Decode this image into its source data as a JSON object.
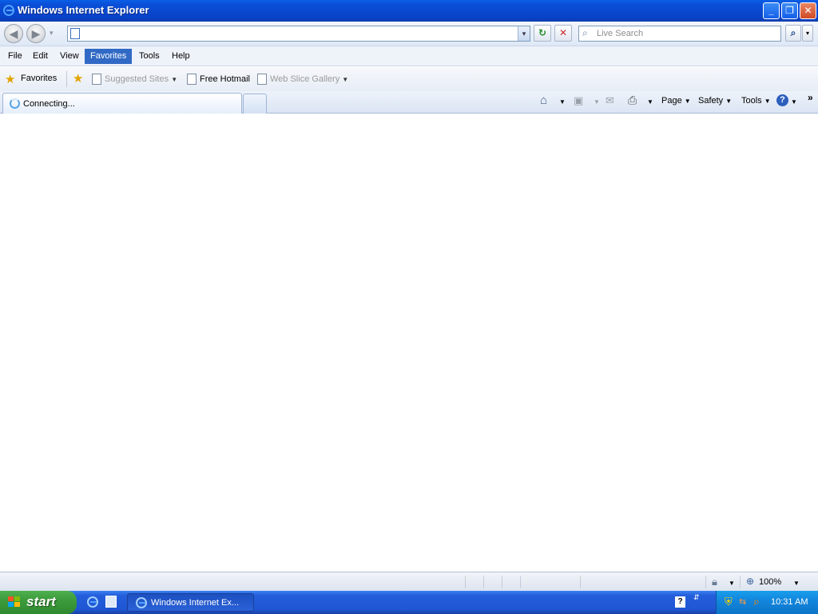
{
  "window": {
    "title": "Windows Internet Explorer"
  },
  "address": {
    "url": "",
    "search_placeholder": "Live Search"
  },
  "menu": [
    "File",
    "Edit",
    "View",
    "Favorites",
    "Tools",
    "Help"
  ],
  "menu_active": "Favorites",
  "favorites_bar": {
    "favorites_label": "Favorites",
    "items": [
      "Suggested Sites",
      "Free Hotmail",
      "Web Slice Gallery"
    ]
  },
  "tab": {
    "label": "Connecting..."
  },
  "command_bar": {
    "page": "Page",
    "safety": "Safety",
    "tools": "Tools"
  },
  "status_bar": {
    "zoom": "100%"
  },
  "taskbar": {
    "start_label": "start",
    "task_label": "Windows Internet Ex...",
    "clock": "10:31 AM"
  }
}
